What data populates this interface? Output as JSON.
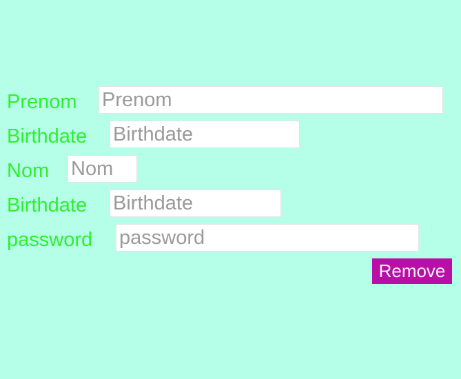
{
  "form": {
    "prenom": {
      "label": "Prenom",
      "placeholder": "Prenom",
      "value": ""
    },
    "birthdate1": {
      "label": "Birthdate",
      "placeholder": "Birthdate",
      "value": ""
    },
    "nom": {
      "label": "Nom",
      "placeholder": "Nom",
      "value": ""
    },
    "birthdate2": {
      "label": "Birthdate",
      "placeholder": "Birthdate",
      "value": ""
    },
    "password": {
      "label": "password",
      "placeholder": "password",
      "value": ""
    },
    "remove_label": "Remove"
  },
  "colors": {
    "background": "#b5ffe9",
    "label_text": "#2ef02e",
    "remove_button": "#b90fa6",
    "placeholder_text": "#9a9a9a"
  }
}
